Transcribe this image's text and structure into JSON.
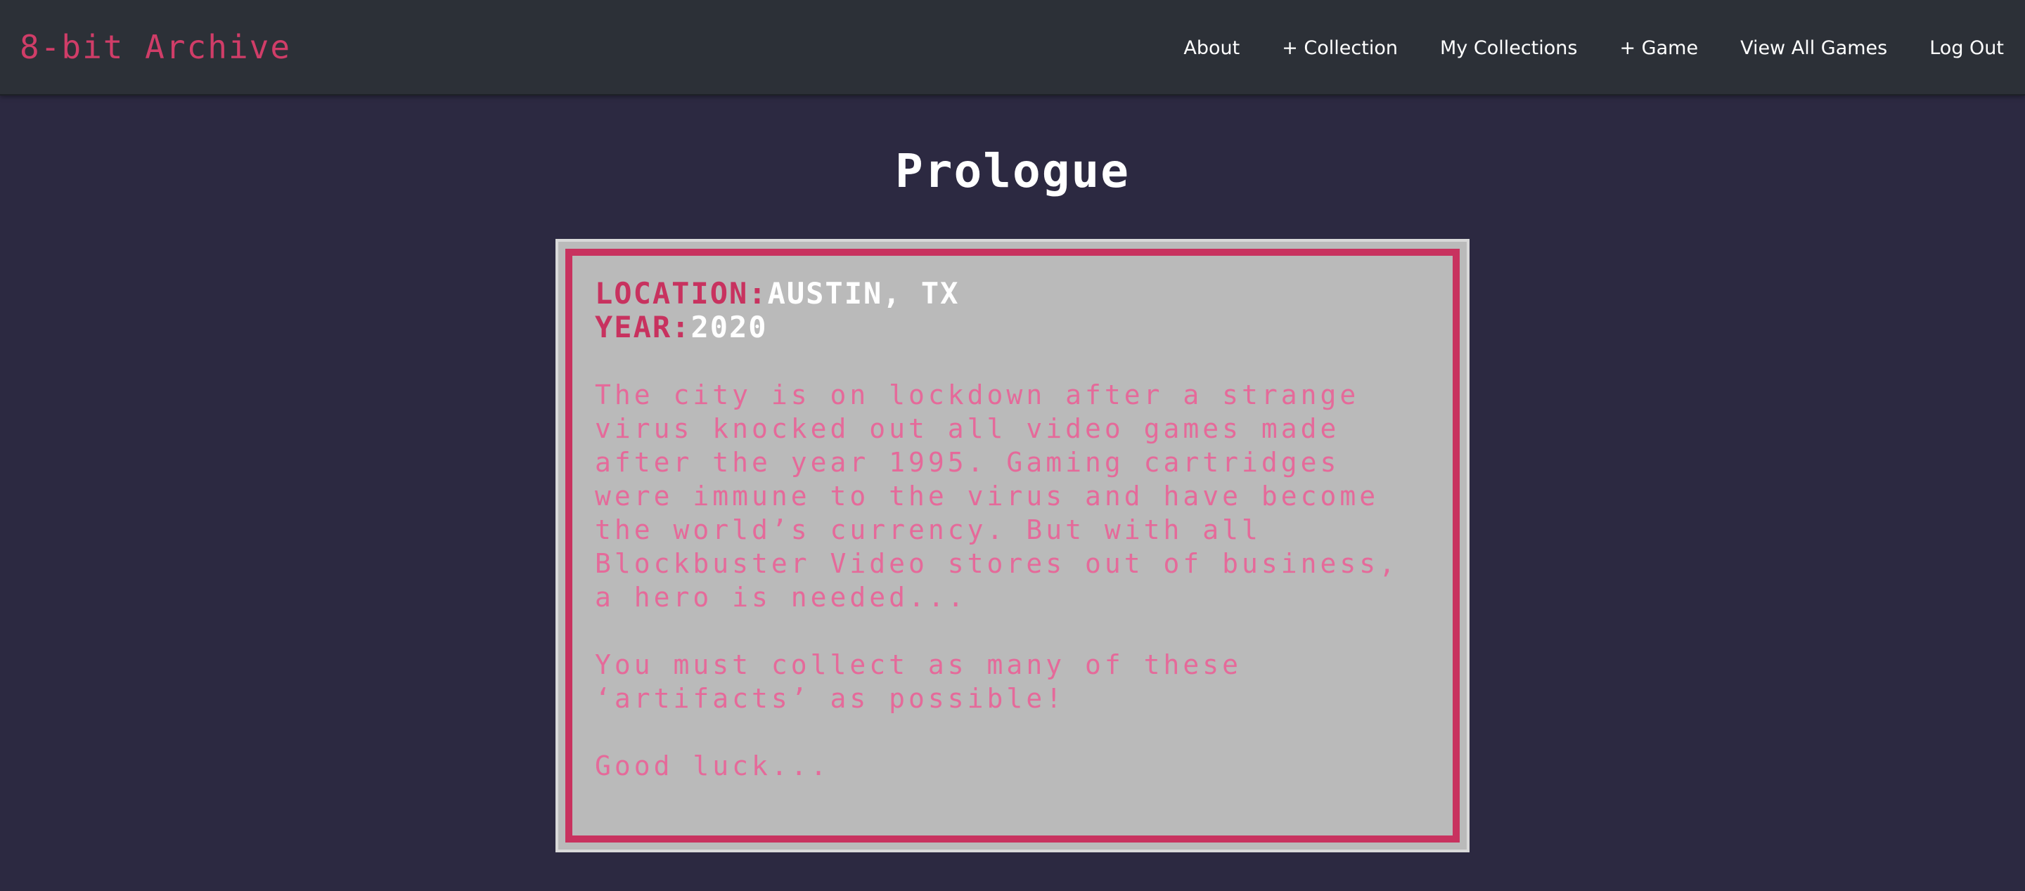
{
  "navbar": {
    "brand": "8-bit Archive",
    "links": [
      {
        "label": "About"
      },
      {
        "label": "+ Collection"
      },
      {
        "label": "My Collections"
      },
      {
        "label": "+ Game"
      },
      {
        "label": "View All Games"
      },
      {
        "label": "Log Out"
      }
    ]
  },
  "page": {
    "title": "Prologue"
  },
  "prologue": {
    "location_label": "LOCATION:",
    "location_value": "AUSTIN, TX",
    "year_label": "YEAR:",
    "year_value": "2020",
    "paragraph_1": "The city is on lockdown after a strange virus knocked out all video games made after the year 1995. Gaming cartridges were immune to the virus and have become the world’s currency. But with all Blockbuster Video stores out of business, a hero is needed...",
    "paragraph_2": "You must collect as many of these ‘artifacts’ as possible!",
    "paragraph_3": "Good luck..."
  },
  "colors": {
    "background": "#2c2941",
    "navbar": "#2c3037",
    "brand_accent": "#d03d68",
    "card_fill": "#bababa",
    "card_border": "#c8325f",
    "story_text": "#e56a9a"
  }
}
